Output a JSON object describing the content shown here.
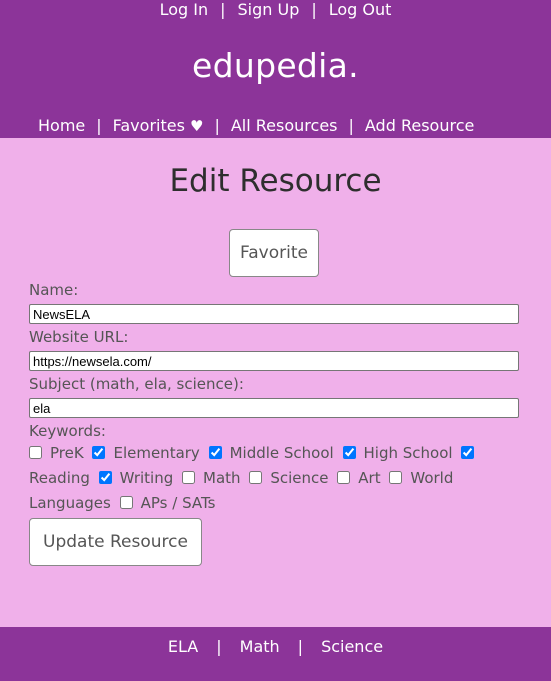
{
  "auth_nav": {
    "login": "Log In",
    "signup": "Sign Up",
    "logout": "Log Out",
    "separator": "|"
  },
  "brand": "edupedia.",
  "main_nav": {
    "home": "Home",
    "favorites": "Favorites",
    "heart": "♥",
    "all_resources": "All Resources",
    "add_resource": "Add Resource",
    "separator": "|"
  },
  "page_title": "Edit Resource",
  "favorite_button": "Favorite",
  "form": {
    "name_label": "Name:",
    "name_value": "NewsELA",
    "url_label": "Website URL:",
    "url_value": "https://newsela.com/",
    "subject_label": "Subject (math, ela, science):",
    "subject_value": "ela",
    "keywords_label": "Keywords:",
    "keywords": [
      {
        "label": "PreK",
        "checked": false
      },
      {
        "label": "Elementary",
        "checked": true
      },
      {
        "label": "Middle School",
        "checked": true
      },
      {
        "label": "High School",
        "checked": true
      },
      {
        "label": "Reading",
        "checked": true
      },
      {
        "label": "Writing",
        "checked": true
      },
      {
        "label": "Math",
        "checked": false
      },
      {
        "label": "Science",
        "checked": false
      },
      {
        "label": "Art",
        "checked": false
      },
      {
        "label": "World Languages",
        "checked": false
      },
      {
        "label": "APs / SATs",
        "checked": false
      }
    ],
    "update_button": "Update Resource"
  },
  "footer": {
    "ela": "ELA",
    "math": "Math",
    "science": "Science",
    "separator": "|"
  },
  "colors": {
    "header_bg": "#8c3499",
    "page_bg": "#f0b0ea"
  }
}
